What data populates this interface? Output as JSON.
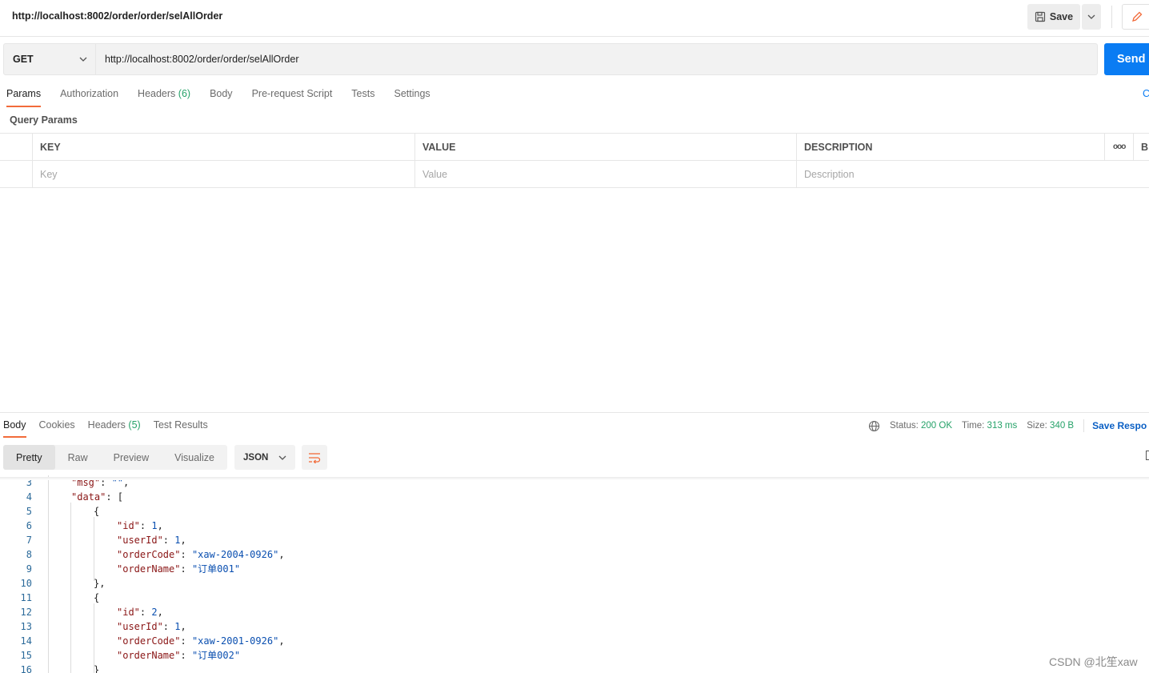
{
  "request": {
    "title": "http://localhost:8002/order/order/selAllOrder",
    "save_label": "Save",
    "method": "GET",
    "url": "http://localhost:8002/order/order/selAllOrder",
    "send_label": "Send"
  },
  "tabs": {
    "params": "Params",
    "authorization": "Authorization",
    "headers": "Headers",
    "headers_count": "(6)",
    "body": "Body",
    "prerequest": "Pre-request Script",
    "tests": "Tests",
    "settings": "Settings",
    "cookies_partial": "C"
  },
  "query_params": {
    "title": "Query Params",
    "col_key": "KEY",
    "col_value": "VALUE",
    "col_description": "DESCRIPTION",
    "more": "ooo",
    "bulk_partial": "B",
    "key_placeholder": "Key",
    "value_placeholder": "Value",
    "description_placeholder": "Description"
  },
  "response": {
    "tabs": {
      "body": "Body",
      "cookies": "Cookies",
      "headers": "Headers",
      "headers_count": "(5)",
      "test_results": "Test Results"
    },
    "status_label": "Status:",
    "status_value": "200 OK",
    "time_label": "Time:",
    "time_value": "313 ms",
    "size_label": "Size:",
    "size_value": "340 B",
    "save_response": "Save Respo",
    "views": {
      "pretty": "Pretty",
      "raw": "Raw",
      "preview": "Preview",
      "visualize": "Visualize"
    },
    "format": "JSON"
  },
  "code_lines": [
    {
      "n": "3",
      "indent": 0,
      "parts": [
        {
          "t": "k",
          "v": "\"msg\""
        },
        {
          "t": "p",
          "v": ": "
        },
        {
          "t": "s",
          "v": "\"\""
        },
        {
          "t": "p",
          "v": ","
        }
      ]
    },
    {
      "n": "4",
      "indent": 0,
      "parts": [
        {
          "t": "k",
          "v": "\"data\""
        },
        {
          "t": "p",
          "v": ": ["
        }
      ]
    },
    {
      "n": "5",
      "indent": 1,
      "parts": [
        {
          "t": "p",
          "v": "{"
        }
      ]
    },
    {
      "n": "6",
      "indent": 2,
      "parts": [
        {
          "t": "k",
          "v": "\"id\""
        },
        {
          "t": "p",
          "v": ": "
        },
        {
          "t": "n",
          "v": "1"
        },
        {
          "t": "p",
          "v": ","
        }
      ]
    },
    {
      "n": "7",
      "indent": 2,
      "parts": [
        {
          "t": "k",
          "v": "\"userId\""
        },
        {
          "t": "p",
          "v": ": "
        },
        {
          "t": "n",
          "v": "1"
        },
        {
          "t": "p",
          "v": ","
        }
      ]
    },
    {
      "n": "8",
      "indent": 2,
      "parts": [
        {
          "t": "k",
          "v": "\"orderCode\""
        },
        {
          "t": "p",
          "v": ": "
        },
        {
          "t": "s",
          "v": "\"xaw-2004-0926\""
        },
        {
          "t": "p",
          "v": ","
        }
      ]
    },
    {
      "n": "9",
      "indent": 2,
      "parts": [
        {
          "t": "k",
          "v": "\"orderName\""
        },
        {
          "t": "p",
          "v": ": "
        },
        {
          "t": "s",
          "v": "\"订单001\""
        }
      ]
    },
    {
      "n": "10",
      "indent": 1,
      "parts": [
        {
          "t": "p",
          "v": "},"
        }
      ]
    },
    {
      "n": "11",
      "indent": 1,
      "parts": [
        {
          "t": "p",
          "v": "{"
        }
      ]
    },
    {
      "n": "12",
      "indent": 2,
      "parts": [
        {
          "t": "k",
          "v": "\"id\""
        },
        {
          "t": "p",
          "v": ": "
        },
        {
          "t": "n",
          "v": "2"
        },
        {
          "t": "p",
          "v": ","
        }
      ]
    },
    {
      "n": "13",
      "indent": 2,
      "parts": [
        {
          "t": "k",
          "v": "\"userId\""
        },
        {
          "t": "p",
          "v": ": "
        },
        {
          "t": "n",
          "v": "1"
        },
        {
          "t": "p",
          "v": ","
        }
      ]
    },
    {
      "n": "14",
      "indent": 2,
      "parts": [
        {
          "t": "k",
          "v": "\"orderCode\""
        },
        {
          "t": "p",
          "v": ": "
        },
        {
          "t": "s",
          "v": "\"xaw-2001-0926\""
        },
        {
          "t": "p",
          "v": ","
        }
      ]
    },
    {
      "n": "15",
      "indent": 2,
      "parts": [
        {
          "t": "k",
          "v": "\"orderName\""
        },
        {
          "t": "p",
          "v": ": "
        },
        {
          "t": "s",
          "v": "\"订单002\""
        }
      ]
    },
    {
      "n": "16",
      "indent": 1,
      "parts": [
        {
          "t": "p",
          "v": "}"
        }
      ]
    }
  ],
  "watermark": "CSDN @北笙xaw"
}
